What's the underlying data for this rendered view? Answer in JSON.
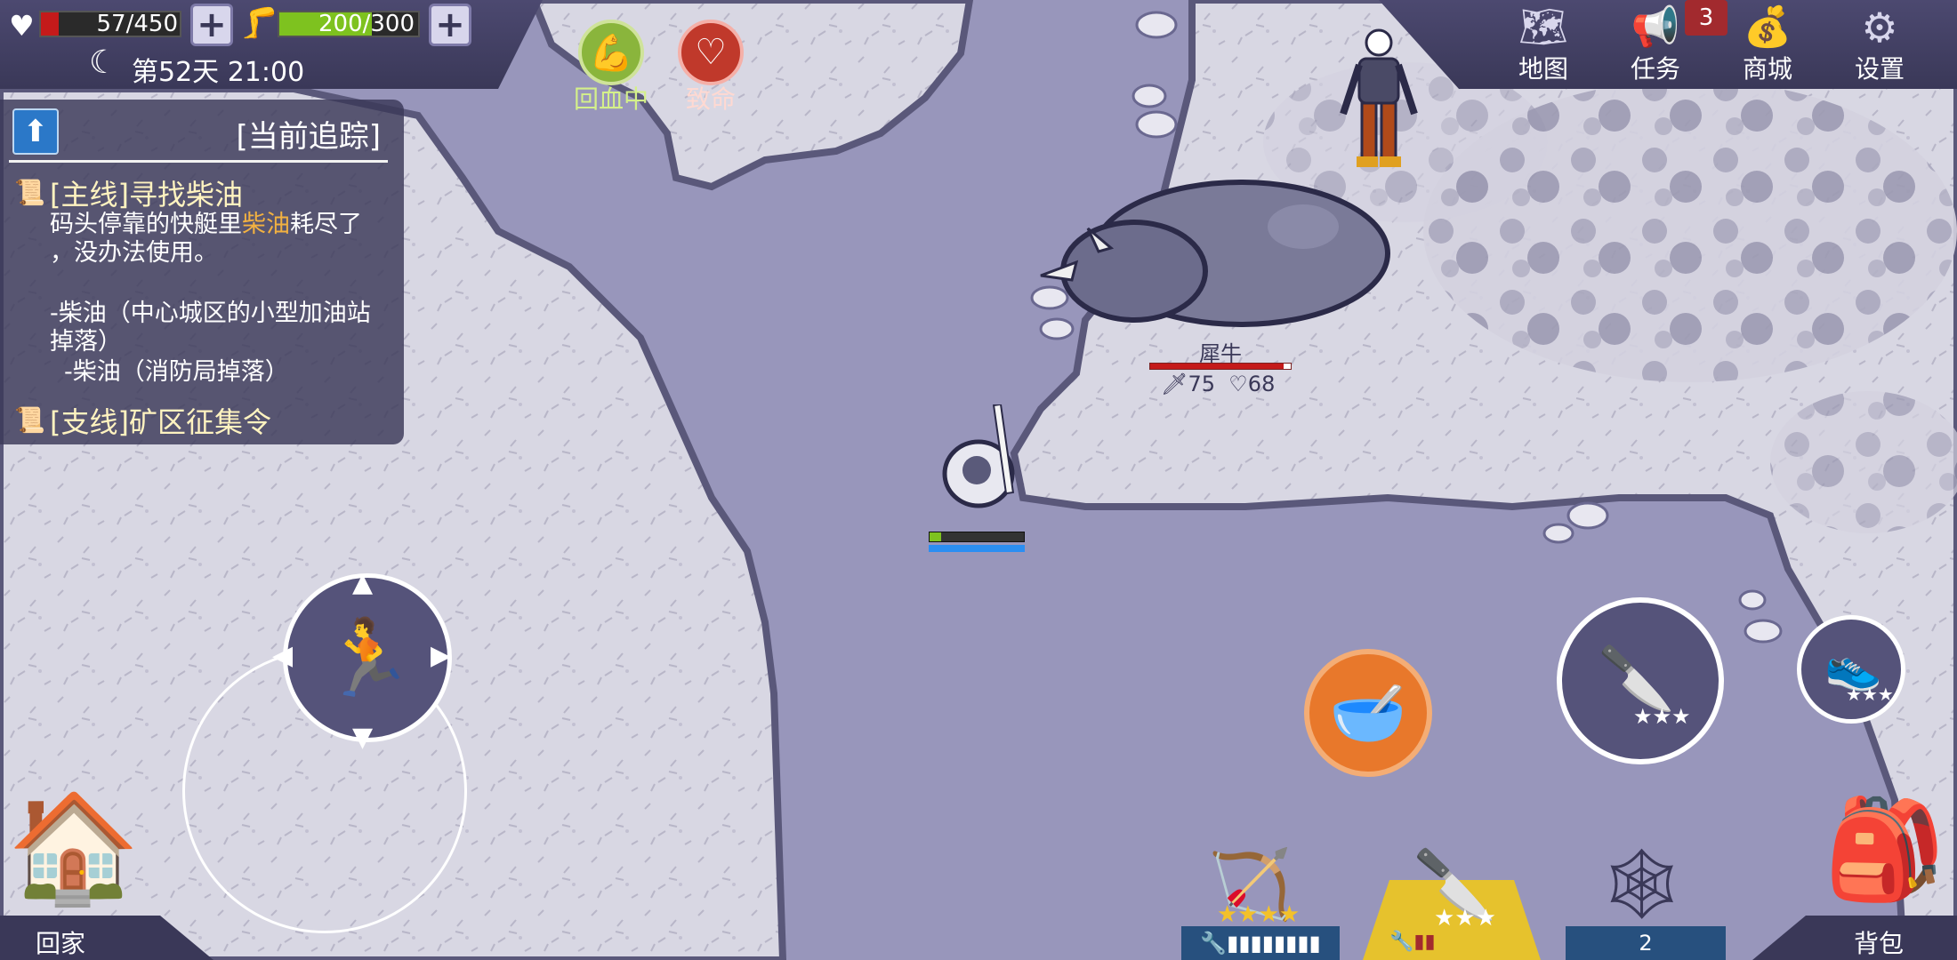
{
  "hud": {
    "health_value": "57/450",
    "health_fill": 0.127,
    "stamina_value": "200/300",
    "stamina_fill": 0.667,
    "day_time": "第52天 21:00"
  },
  "status_effects": [
    {
      "label": "回血中",
      "icon": "muscle-regen-icon",
      "color": "#8ab53c"
    },
    {
      "label": "致命",
      "icon": "heart-fatal-icon",
      "color": "#c0392b"
    }
  ],
  "quest_panel": {
    "header": "[当前追踪]",
    "main_title": "[主线]寻找柴油",
    "desc_line1_a": "码头停靠的快艇里",
    "desc_line1_hl": "柴油",
    "desc_line1_b": "耗尽了",
    "desc_line2": "，没办法使用。",
    "req1_line1": "-柴油（中心城区的小型加油站",
    "req1_line2": "掉落）",
    "req2": "-柴油（消防局掉落）",
    "side_title": "[支线]矿区征集令"
  },
  "menu": [
    {
      "label": "地图",
      "icon": "map-icon"
    },
    {
      "label": "任务",
      "icon": "megaphone-icon",
      "badge": "3"
    },
    {
      "label": "商城",
      "icon": "coins-icon"
    },
    {
      "label": "设置",
      "icon": "gear-icon"
    }
  ],
  "enemy": {
    "name": "犀牛",
    "attack": "75",
    "hp": "68",
    "hp_fill": 0.95
  },
  "player": {
    "health_fill": 0.12,
    "energy_fill": 1.0
  },
  "bottom": {
    "home_label": "回家",
    "bag_label": "背包",
    "slot3_count": "2"
  },
  "colors": {
    "ui_dark": "#3a3858",
    "accent_orange": "#e8782b",
    "health_red": "#c41a1a",
    "stamina_green": "#7ec21f",
    "slot_blue": "#27507e",
    "slot_gold": "#e6c22d"
  }
}
